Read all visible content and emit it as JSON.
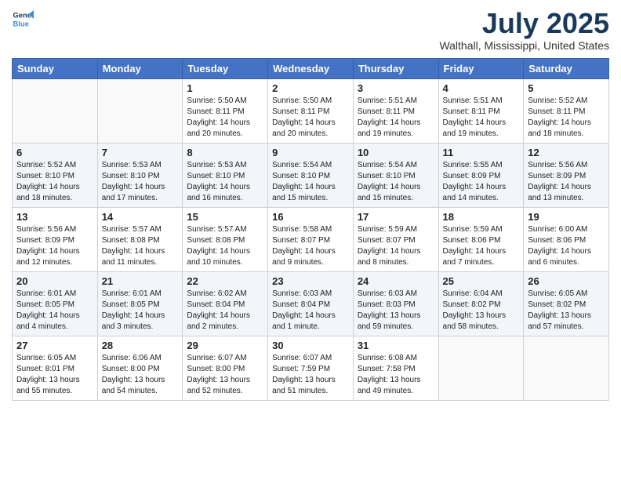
{
  "logo": {
    "line1": "General",
    "line2": "Blue"
  },
  "title": "July 2025",
  "subtitle": "Walthall, Mississippi, United States",
  "days_of_week": [
    "Sunday",
    "Monday",
    "Tuesday",
    "Wednesday",
    "Thursday",
    "Friday",
    "Saturday"
  ],
  "weeks": [
    [
      {
        "day": "",
        "sunrise": "",
        "sunset": "",
        "daylight": ""
      },
      {
        "day": "",
        "sunrise": "",
        "sunset": "",
        "daylight": ""
      },
      {
        "day": "1",
        "sunrise": "Sunrise: 5:50 AM",
        "sunset": "Sunset: 8:11 PM",
        "daylight": "Daylight: 14 hours and 20 minutes."
      },
      {
        "day": "2",
        "sunrise": "Sunrise: 5:50 AM",
        "sunset": "Sunset: 8:11 PM",
        "daylight": "Daylight: 14 hours and 20 minutes."
      },
      {
        "day": "3",
        "sunrise": "Sunrise: 5:51 AM",
        "sunset": "Sunset: 8:11 PM",
        "daylight": "Daylight: 14 hours and 19 minutes."
      },
      {
        "day": "4",
        "sunrise": "Sunrise: 5:51 AM",
        "sunset": "Sunset: 8:11 PM",
        "daylight": "Daylight: 14 hours and 19 minutes."
      },
      {
        "day": "5",
        "sunrise": "Sunrise: 5:52 AM",
        "sunset": "Sunset: 8:11 PM",
        "daylight": "Daylight: 14 hours and 18 minutes."
      }
    ],
    [
      {
        "day": "6",
        "sunrise": "Sunrise: 5:52 AM",
        "sunset": "Sunset: 8:10 PM",
        "daylight": "Daylight: 14 hours and 18 minutes."
      },
      {
        "day": "7",
        "sunrise": "Sunrise: 5:53 AM",
        "sunset": "Sunset: 8:10 PM",
        "daylight": "Daylight: 14 hours and 17 minutes."
      },
      {
        "day": "8",
        "sunrise": "Sunrise: 5:53 AM",
        "sunset": "Sunset: 8:10 PM",
        "daylight": "Daylight: 14 hours and 16 minutes."
      },
      {
        "day": "9",
        "sunrise": "Sunrise: 5:54 AM",
        "sunset": "Sunset: 8:10 PM",
        "daylight": "Daylight: 14 hours and 15 minutes."
      },
      {
        "day": "10",
        "sunrise": "Sunrise: 5:54 AM",
        "sunset": "Sunset: 8:10 PM",
        "daylight": "Daylight: 14 hours and 15 minutes."
      },
      {
        "day": "11",
        "sunrise": "Sunrise: 5:55 AM",
        "sunset": "Sunset: 8:09 PM",
        "daylight": "Daylight: 14 hours and 14 minutes."
      },
      {
        "day": "12",
        "sunrise": "Sunrise: 5:56 AM",
        "sunset": "Sunset: 8:09 PM",
        "daylight": "Daylight: 14 hours and 13 minutes."
      }
    ],
    [
      {
        "day": "13",
        "sunrise": "Sunrise: 5:56 AM",
        "sunset": "Sunset: 8:09 PM",
        "daylight": "Daylight: 14 hours and 12 minutes."
      },
      {
        "day": "14",
        "sunrise": "Sunrise: 5:57 AM",
        "sunset": "Sunset: 8:08 PM",
        "daylight": "Daylight: 14 hours and 11 minutes."
      },
      {
        "day": "15",
        "sunrise": "Sunrise: 5:57 AM",
        "sunset": "Sunset: 8:08 PM",
        "daylight": "Daylight: 14 hours and 10 minutes."
      },
      {
        "day": "16",
        "sunrise": "Sunrise: 5:58 AM",
        "sunset": "Sunset: 8:07 PM",
        "daylight": "Daylight: 14 hours and 9 minutes."
      },
      {
        "day": "17",
        "sunrise": "Sunrise: 5:59 AM",
        "sunset": "Sunset: 8:07 PM",
        "daylight": "Daylight: 14 hours and 8 minutes."
      },
      {
        "day": "18",
        "sunrise": "Sunrise: 5:59 AM",
        "sunset": "Sunset: 8:06 PM",
        "daylight": "Daylight: 14 hours and 7 minutes."
      },
      {
        "day": "19",
        "sunrise": "Sunrise: 6:00 AM",
        "sunset": "Sunset: 8:06 PM",
        "daylight": "Daylight: 14 hours and 6 minutes."
      }
    ],
    [
      {
        "day": "20",
        "sunrise": "Sunrise: 6:01 AM",
        "sunset": "Sunset: 8:05 PM",
        "daylight": "Daylight: 14 hours and 4 minutes."
      },
      {
        "day": "21",
        "sunrise": "Sunrise: 6:01 AM",
        "sunset": "Sunset: 8:05 PM",
        "daylight": "Daylight: 14 hours and 3 minutes."
      },
      {
        "day": "22",
        "sunrise": "Sunrise: 6:02 AM",
        "sunset": "Sunset: 8:04 PM",
        "daylight": "Daylight: 14 hours and 2 minutes."
      },
      {
        "day": "23",
        "sunrise": "Sunrise: 6:03 AM",
        "sunset": "Sunset: 8:04 PM",
        "daylight": "Daylight: 14 hours and 1 minute."
      },
      {
        "day": "24",
        "sunrise": "Sunrise: 6:03 AM",
        "sunset": "Sunset: 8:03 PM",
        "daylight": "Daylight: 13 hours and 59 minutes."
      },
      {
        "day": "25",
        "sunrise": "Sunrise: 6:04 AM",
        "sunset": "Sunset: 8:02 PM",
        "daylight": "Daylight: 13 hours and 58 minutes."
      },
      {
        "day": "26",
        "sunrise": "Sunrise: 6:05 AM",
        "sunset": "Sunset: 8:02 PM",
        "daylight": "Daylight: 13 hours and 57 minutes."
      }
    ],
    [
      {
        "day": "27",
        "sunrise": "Sunrise: 6:05 AM",
        "sunset": "Sunset: 8:01 PM",
        "daylight": "Daylight: 13 hours and 55 minutes."
      },
      {
        "day": "28",
        "sunrise": "Sunrise: 6:06 AM",
        "sunset": "Sunset: 8:00 PM",
        "daylight": "Daylight: 13 hours and 54 minutes."
      },
      {
        "day": "29",
        "sunrise": "Sunrise: 6:07 AM",
        "sunset": "Sunset: 8:00 PM",
        "daylight": "Daylight: 13 hours and 52 minutes."
      },
      {
        "day": "30",
        "sunrise": "Sunrise: 6:07 AM",
        "sunset": "Sunset: 7:59 PM",
        "daylight": "Daylight: 13 hours and 51 minutes."
      },
      {
        "day": "31",
        "sunrise": "Sunrise: 6:08 AM",
        "sunset": "Sunset: 7:58 PM",
        "daylight": "Daylight: 13 hours and 49 minutes."
      },
      {
        "day": "",
        "sunrise": "",
        "sunset": "",
        "daylight": ""
      },
      {
        "day": "",
        "sunrise": "",
        "sunset": "",
        "daylight": ""
      }
    ]
  ]
}
